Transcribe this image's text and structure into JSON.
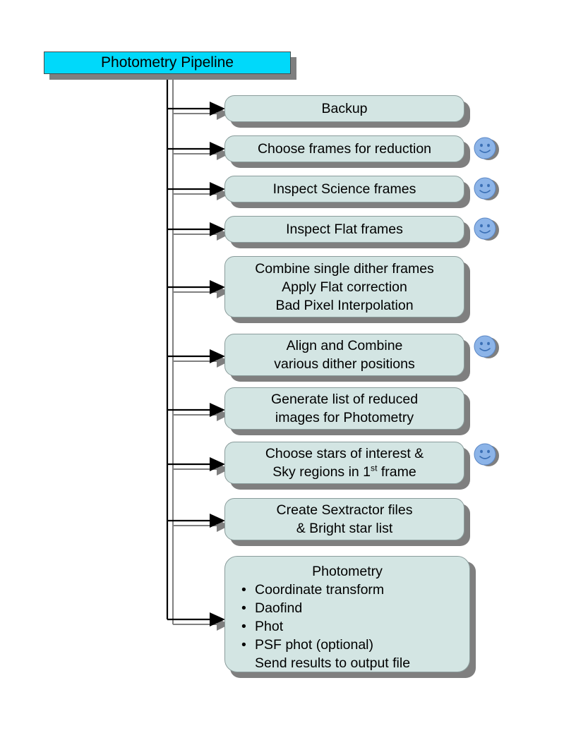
{
  "diagram": {
    "title": "Photometry Pipeline",
    "title_color": "#00d9fa",
    "node_fill": "#d3e5e3",
    "node_border": "#8a9c9b",
    "shadow_color": "#7f7f7f",
    "smiley_fill": "#8cb4e8",
    "smiley_stroke": "#3a6fb5",
    "connector_color": "#000000",
    "connector_shadow_color": "#7f7f7f"
  },
  "steps": [
    {
      "id": "backup",
      "lines": [
        "Backup"
      ],
      "user_interaction": false
    },
    {
      "id": "choose-frames",
      "lines": [
        "Choose frames for reduction"
      ],
      "user_interaction": true
    },
    {
      "id": "inspect-science",
      "lines": [
        "Inspect Science frames"
      ],
      "user_interaction": true
    },
    {
      "id": "inspect-flat",
      "lines": [
        "Inspect Flat frames"
      ],
      "user_interaction": true
    },
    {
      "id": "combine-dither",
      "lines": [
        "Combine single dither frames",
        "Apply Flat correction",
        "Bad Pixel Interpolation"
      ],
      "user_interaction": false
    },
    {
      "id": "align-combine",
      "lines": [
        "Align and Combine",
        "various dither positions"
      ],
      "user_interaction": true
    },
    {
      "id": "generate-list",
      "lines": [
        "Generate list of reduced",
        "images for Photometry"
      ],
      "user_interaction": false
    },
    {
      "id": "choose-stars",
      "lines_rich": [
        "Choose stars of interest &",
        "Sky regions in 1|st| frame"
      ],
      "lines": [
        "Choose stars of interest &",
        "Sky regions in 1st frame"
      ],
      "user_interaction": true
    },
    {
      "id": "create-sextractor",
      "lines": [
        "Create Sextractor files",
        "& Bright star list"
      ],
      "user_interaction": false
    }
  ],
  "photometry_step": {
    "id": "photometry",
    "header": "Photometry",
    "bullets": [
      "Coordinate transform",
      "Daofind",
      "Phot",
      "PSF phot (optional)"
    ],
    "bullet_glyph": "•",
    "trailing_line": "Send results to output file",
    "user_interaction": false
  }
}
